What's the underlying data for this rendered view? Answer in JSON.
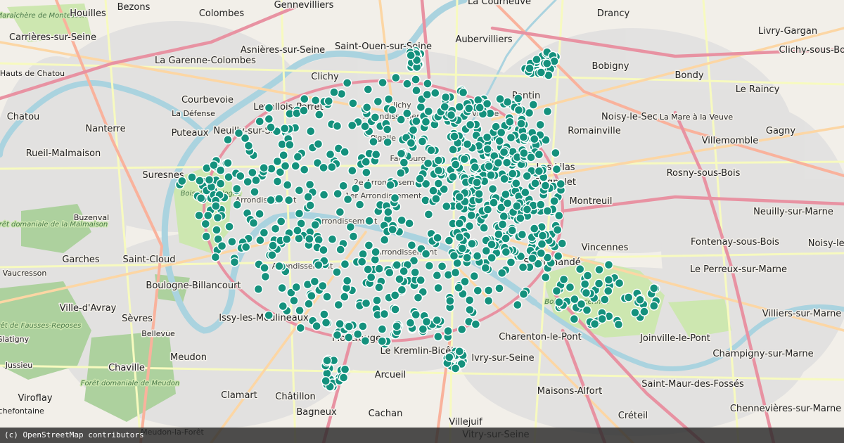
{
  "map": {
    "attribution": "(c) OpenStreetMap contributors",
    "colors": {
      "marker": "#14917d",
      "marker_outline": "#ffffff",
      "land": "#f2efe9",
      "urban": "#e0dfdf",
      "park": "#cde7b0",
      "forest": "#add19e",
      "water": "#aad3df",
      "motorway": "#e892a2",
      "trunk": "#f9b29c",
      "primary": "#fcd6a4",
      "secondary": "#f7fabf"
    },
    "marker_icon": "circle-marker-icon",
    "labels": [
      {
        "text": "La Plaine Maraîchère de Montesson",
        "kind": "park"
      },
      {
        "text": "Houilles",
        "kind": "major"
      },
      {
        "text": "Bezons",
        "kind": "major"
      },
      {
        "text": "Colombes",
        "kind": "major"
      },
      {
        "text": "Gennevilliers",
        "kind": "major"
      },
      {
        "text": "La Courneuve",
        "kind": "major"
      },
      {
        "text": "Drancy",
        "kind": "major"
      },
      {
        "text": "Carrières-sur-Seine",
        "kind": "major"
      },
      {
        "text": "La Garenne-Colombes",
        "kind": "major"
      },
      {
        "text": "Asnières-sur-Seine",
        "kind": "major"
      },
      {
        "text": "Saint-Ouen-sur-Seine",
        "kind": "major"
      },
      {
        "text": "Aubervilliers",
        "kind": "major"
      },
      {
        "text": "Livry-Gargan",
        "kind": "major"
      },
      {
        "text": "Clichy-sous-Bois",
        "kind": "major"
      },
      {
        "text": "Les Hauts de Chatou",
        "kind": "minor"
      },
      {
        "text": "Clichy",
        "kind": "major"
      },
      {
        "text": "Bobigny",
        "kind": "major"
      },
      {
        "text": "Bondy",
        "kind": "major"
      },
      {
        "text": "Le Raincy",
        "kind": "major"
      },
      {
        "text": "Chatou",
        "kind": "major"
      },
      {
        "text": "Nanterre",
        "kind": "major"
      },
      {
        "text": "Courbevoie",
        "kind": "major"
      },
      {
        "text": "La Défense",
        "kind": "minor"
      },
      {
        "text": "Levallois-Perret",
        "kind": "major"
      },
      {
        "text": "Pantin",
        "kind": "major"
      },
      {
        "text": "Noisy-le-Sec",
        "kind": "major"
      },
      {
        "text": "La Mare à la Veuve",
        "kind": "minor"
      },
      {
        "text": "Puteaux",
        "kind": "major"
      },
      {
        "text": "Neuilly-sur-Seine",
        "kind": "major"
      },
      {
        "text": "Romainville",
        "kind": "major"
      },
      {
        "text": "Gagny",
        "kind": "major"
      },
      {
        "text": "Villemomble",
        "kind": "major"
      },
      {
        "text": "Rueil-Malmaison",
        "kind": "major"
      },
      {
        "text": "Les Lilas",
        "kind": "major"
      },
      {
        "text": "Suresnes",
        "kind": "major"
      },
      {
        "text": "Bagnolet",
        "kind": "major"
      },
      {
        "text": "Rosny-sous-Bois",
        "kind": "major"
      },
      {
        "text": "Montreuil",
        "kind": "major"
      },
      {
        "text": "Neuilly-sur-Marne",
        "kind": "major"
      },
      {
        "text": "Buzenval",
        "kind": "minor"
      },
      {
        "text": "Forêt domaniale de la Malmaison",
        "kind": "park"
      },
      {
        "text": "Fontenay-sous-Bois",
        "kind": "major"
      },
      {
        "text": "Noisy-le-Gr",
        "kind": "major"
      },
      {
        "text": "Vincennes",
        "kind": "major"
      },
      {
        "text": "Garches",
        "kind": "major"
      },
      {
        "text": "Saint-Cloud",
        "kind": "major"
      },
      {
        "text": "Saint-Mandé",
        "kind": "major"
      },
      {
        "text": "Le Perreux-sur-Marne",
        "kind": "major"
      },
      {
        "text": "Vaucresson",
        "kind": "minor"
      },
      {
        "text": "Boulogne-Billancourt",
        "kind": "major"
      },
      {
        "text": "Bois de Vincennes",
        "kind": "park"
      },
      {
        "text": "Ville-d'Avray",
        "kind": "major"
      },
      {
        "text": "Villiers-sur-Marne",
        "kind": "major"
      },
      {
        "text": "Forêt de Fausses-Reposes",
        "kind": "park"
      },
      {
        "text": "Sèvres",
        "kind": "major"
      },
      {
        "text": "Issy-les-Moulineaux",
        "kind": "major"
      },
      {
        "text": "Charenton-le-Pont",
        "kind": "major"
      },
      {
        "text": "Joinville-le-Pont",
        "kind": "major"
      },
      {
        "text": "Glatigny",
        "kind": "minor"
      },
      {
        "text": "Bellevue",
        "kind": "minor"
      },
      {
        "text": "Montrouge",
        "kind": "major"
      },
      {
        "text": "Le Kremlin-Bicêtre",
        "kind": "major"
      },
      {
        "text": "Ivry-sur-Seine",
        "kind": "major"
      },
      {
        "text": "Champigny-sur-Marne",
        "kind": "major"
      },
      {
        "text": "Jussieu",
        "kind": "minor"
      },
      {
        "text": "Meudon",
        "kind": "major"
      },
      {
        "text": "Chaville",
        "kind": "major"
      },
      {
        "text": "Forêt domaniale de Meudon",
        "kind": "park"
      },
      {
        "text": "Arcueil",
        "kind": "major"
      },
      {
        "text": "Maisons-Alfort",
        "kind": "major"
      },
      {
        "text": "Saint-Maur-des-Fossés",
        "kind": "major"
      },
      {
        "text": "Viroflay",
        "kind": "major"
      },
      {
        "text": "Clamart",
        "kind": "major"
      },
      {
        "text": "Châtillon",
        "kind": "major"
      },
      {
        "text": "Créteil",
        "kind": "major"
      },
      {
        "text": "Chennevières-sur-Marne",
        "kind": "major"
      },
      {
        "text": "rchefontaine",
        "kind": "minor"
      },
      {
        "text": "Bagneux",
        "kind": "major"
      },
      {
        "text": "Cachan",
        "kind": "major"
      },
      {
        "text": "Villejuif",
        "kind": "major"
      },
      {
        "text": "Meudon-la-Forêt",
        "kind": "minor"
      },
      {
        "text": "Vitry-sur-Seine",
        "kind": "major"
      },
      {
        "text": "Bois de Boulogne",
        "kind": "park"
      },
      {
        "text": "Clichy",
        "kind": "arr"
      },
      {
        "text": "Villette",
        "kind": "arr"
      },
      {
        "text": "Arrondissement",
        "kind": "arr"
      },
      {
        "text": "Pigalle",
        "kind": "arr"
      },
      {
        "text": "Faubourg",
        "kind": "arr"
      },
      {
        "text": "2e Arrondissement",
        "kind": "arr"
      },
      {
        "text": "1er Arrondissement",
        "kind": "arr"
      },
      {
        "text": "Arrondissement",
        "kind": "arr"
      },
      {
        "text": "Arrondissement",
        "kind": "arr"
      },
      {
        "text": "Arrondissement",
        "kind": "arr"
      },
      {
        "text": "Arrondissement",
        "kind": "arr"
      }
    ]
  }
}
